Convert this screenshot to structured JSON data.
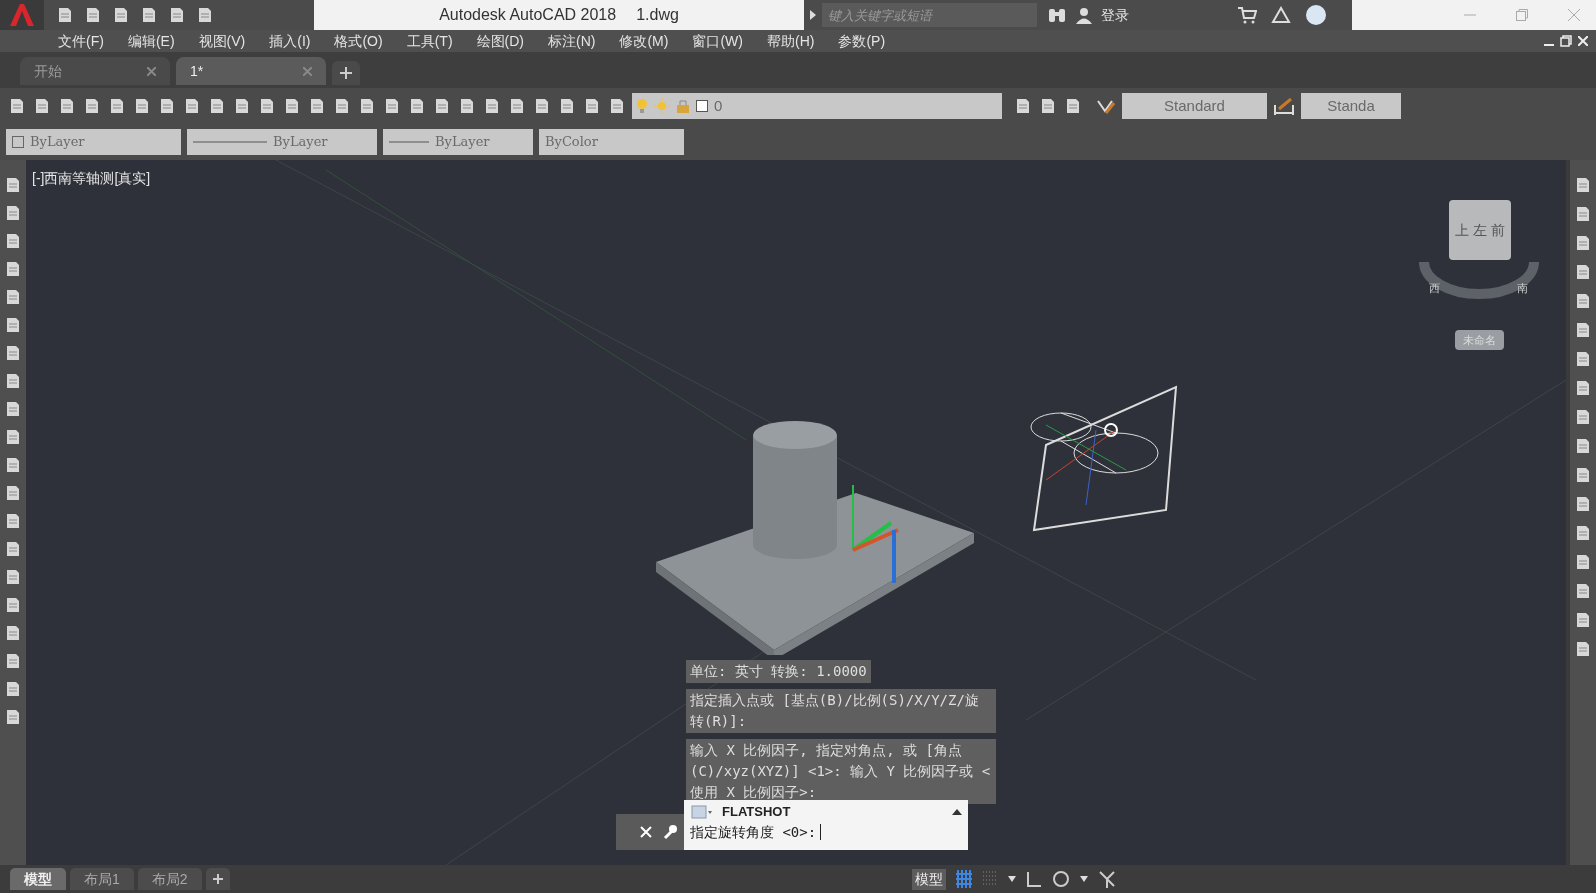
{
  "title_bar": {
    "title": "Autodesk AutoCAD 2018",
    "filename": "1.dwg",
    "search_placeholder": "键入关键字或短语",
    "login": "登录"
  },
  "menu": [
    "文件(F)",
    "编辑(E)",
    "视图(V)",
    "插入(I)",
    "格式(O)",
    "工具(T)",
    "绘图(D)",
    "标注(N)",
    "修改(M)",
    "窗口(W)",
    "帮助(H)",
    "参数(P)"
  ],
  "file_tabs": [
    {
      "label": "开始",
      "selected": false
    },
    {
      "label": "1*",
      "selected": true
    }
  ],
  "layer_toolbar": {
    "layer": "0",
    "text_style": "Standard",
    "dim_style": "Standa"
  },
  "properties": {
    "color_setting": "ByLayer",
    "linetype": "ByLayer",
    "lineweight": "ByLayer",
    "plot_style": "ByColor"
  },
  "viewport": {
    "label": "[-]西南等轴测[真实]",
    "viewcube": {
      "faces": [
        "上",
        "左",
        "前"
      ],
      "compass": [
        "西",
        "南"
      ],
      "ucs_menu": "未命名"
    }
  },
  "command_history": [
    "单位: 英寸   转换:    1.0000",
    "指定插入点或 [基点(B)/比例(S)/X/Y/Z/旋转(R)]:",
    "输入 X 比例因子, 指定对角点, 或 [角点(C)/xyz(XYZ)] <1>:  输入 Y 比例因子或 <使用 X 比例因子>:"
  ],
  "command_line": {
    "command": "FLATSHOT",
    "prompt": "指定旋转角度 <0>:"
  },
  "layout_tabs": [
    {
      "label": "模型",
      "selected": true
    },
    {
      "label": "布局1",
      "selected": false
    },
    {
      "label": "布局2",
      "selected": false
    }
  ],
  "status_bar": {
    "model": "模型"
  }
}
